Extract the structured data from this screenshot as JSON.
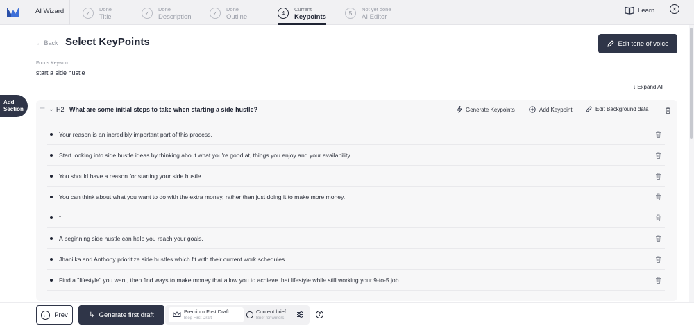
{
  "app": {
    "title": "AI Wizard"
  },
  "steps": [
    {
      "status": "Done",
      "name": "Title",
      "number": "✓"
    },
    {
      "status": "Done",
      "name": "Description",
      "number": "✓"
    },
    {
      "status": "Done",
      "name": "Outline",
      "number": "✓"
    },
    {
      "status": "Current",
      "name": "Keypoints",
      "number": "4"
    },
    {
      "status": "Not yet done",
      "name": "AI Editor",
      "number": "5"
    }
  ],
  "header": {
    "learn_label": "Learn"
  },
  "page": {
    "back_label": "← Back",
    "title": "Select KeyPoints",
    "tone_button": "Edit tone of voice",
    "focus_keyword_label": "Focus Keyword:",
    "focus_keyword": "start a side hustle",
    "expand_all": "↓ Expand All",
    "add_section": "Add Section"
  },
  "section": {
    "heading_tag": "H2",
    "heading": "What are some initial steps to take when starting a side hustle?",
    "actions": {
      "generate": "Generate Keypoints",
      "add": "Add Keypoint",
      "edit_background": "Edit Background data"
    },
    "keypoints": [
      "Your reason is an incredibly important part of this process.",
      "Start looking into side hustle ideas by thinking about what you're good at, things you enjoy and your availability.",
      "You should have a reason for starting your side hustle.",
      "You can think about what you want to do with the extra money, rather than just doing it to make more money.",
      "\"",
      "A beginning side hustle can help you reach your goals.",
      "Jhanilka and Anthony prioritize side hustles which fit with their current work schedules.",
      "Find a \"lifestyle\" you want, then find ways to make money that allow you to achieve that lifestyle while still working your 9-to-5 job."
    ]
  },
  "footer": {
    "prev": "Prev",
    "generate": "Generate first draft",
    "option1_title": "Premium First Draft",
    "option1_sub": "Blog First Draft",
    "option2_title": "Content brief",
    "option2_sub": "Brief for writers",
    "help": "?"
  },
  "colors": {
    "primary": "#2f3548",
    "topbar": "#f1f1f3",
    "panel": "#f7f7f8"
  }
}
